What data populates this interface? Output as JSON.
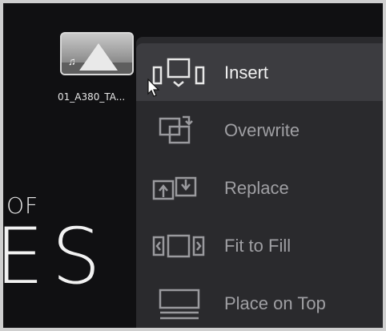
{
  "viewer": {
    "bg_text_small": "OF",
    "bg_text_large": "ES"
  },
  "clip": {
    "name": "01_A380_TA...",
    "icon": "audio-note-icon"
  },
  "overlay_menu": {
    "items": [
      {
        "label": "Insert",
        "icon": "insert-icon",
        "active": true
      },
      {
        "label": "Overwrite",
        "icon": "overwrite-icon",
        "active": false
      },
      {
        "label": "Replace",
        "icon": "replace-icon",
        "active": false
      },
      {
        "label": "Fit to Fill",
        "icon": "fit-to-fill-icon",
        "active": false
      },
      {
        "label": "Place on Top",
        "icon": "place-on-top-icon",
        "active": false
      }
    ]
  },
  "colors": {
    "menu_bg": "#2a2a2d",
    "menu_active_bg": "#3c3c40",
    "label_active": "#f1f1f1",
    "label_inactive": "#9f9fa3"
  }
}
